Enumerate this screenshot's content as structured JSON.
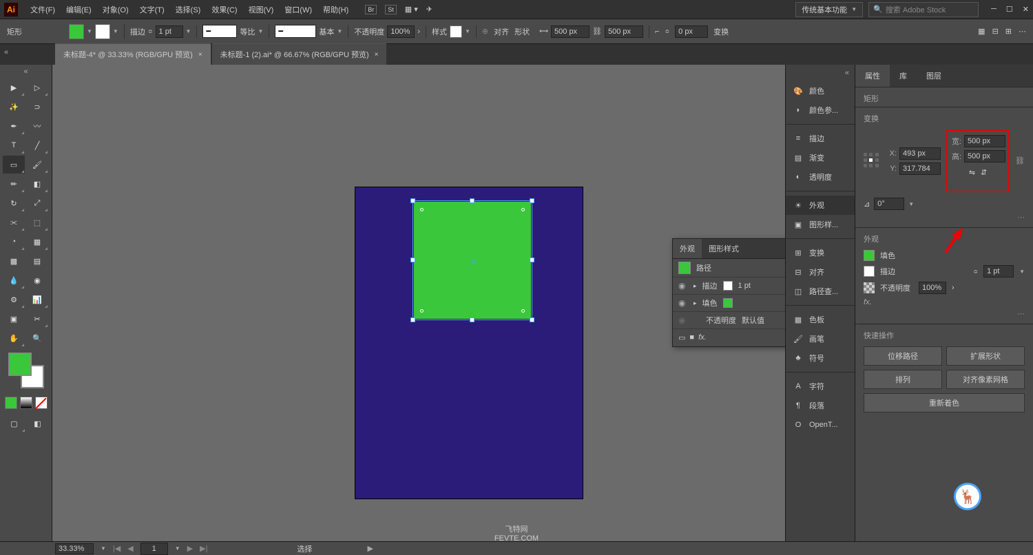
{
  "menubar": {
    "items": [
      "文件(F)",
      "编辑(E)",
      "对象(O)",
      "文字(T)",
      "选择(S)",
      "效果(C)",
      "视图(V)",
      "窗口(W)",
      "帮助(H)"
    ],
    "workspace": "传统基本功能",
    "search_placeholder": "搜索 Adobe Stock"
  },
  "controlbar": {
    "shape_label": "矩形",
    "fill_color": "#3bc73b",
    "stroke_color": "#ffffff",
    "stroke_label": "描边",
    "stroke_weight": "1 pt",
    "proportion_label": "等比",
    "basic_label": "基本",
    "opacity_label": "不透明度",
    "opacity_value": "100%",
    "style_label": "样式",
    "align_label": "对齐",
    "shape_btn_label": "形状",
    "width_value": "500 px",
    "height_value": "500 px",
    "corner_value": "0 px",
    "transform_label": "变换"
  },
  "tabs": [
    {
      "title": "未标题-4* @ 33.33% (RGB/GPU 预览)",
      "active": true
    },
    {
      "title": "未标题-1 (2).ai* @ 66.67% (RGB/GPU 预览)",
      "active": false
    }
  ],
  "float_panel": {
    "tabs": [
      "外观",
      "图形样式"
    ],
    "path_label": "路径",
    "stroke_label": "描边",
    "stroke_value": "1 pt",
    "fill_label": "填色",
    "opacity_label": "不透明度",
    "opacity_default": "默认值"
  },
  "panel_strip": {
    "groups": [
      [
        "颜色",
        "颜色参..."
      ],
      [
        "描边",
        "渐变",
        "透明度"
      ],
      [
        "外观",
        "图形样..."
      ],
      [
        "变换",
        "对齐",
        "路径查..."
      ],
      [
        "色板",
        "画笔",
        "符号"
      ],
      [
        "字符",
        "段落",
        "OpenT..."
      ]
    ]
  },
  "props": {
    "tabs": [
      "属性",
      "库",
      "图层"
    ],
    "shape_type": "矩形",
    "transform_title": "变换",
    "x_label": "X:",
    "x_value": "493 px",
    "y_label": "Y:",
    "y_value": "317.784",
    "w_label": "宽:",
    "w_value": "500 px",
    "h_label": "高:",
    "h_value": "500 px",
    "angle_value": "0°",
    "appearance_title": "外观",
    "fill_label": "填色",
    "stroke_label": "描边",
    "stroke_value": "1 pt",
    "opacity_label": "不透明度",
    "opacity_value": "100%",
    "fx_label": "fx.",
    "quick_title": "快速操作",
    "quick_actions": [
      "位移路径",
      "扩展形状",
      "排列",
      "对齐像素网格",
      "重新着色"
    ]
  },
  "statusbar": {
    "zoom": "33.33%",
    "page": "1",
    "select_label": "选择"
  },
  "watermark": {
    "line1": "飞特网",
    "line2": "FEVTE.COM"
  }
}
